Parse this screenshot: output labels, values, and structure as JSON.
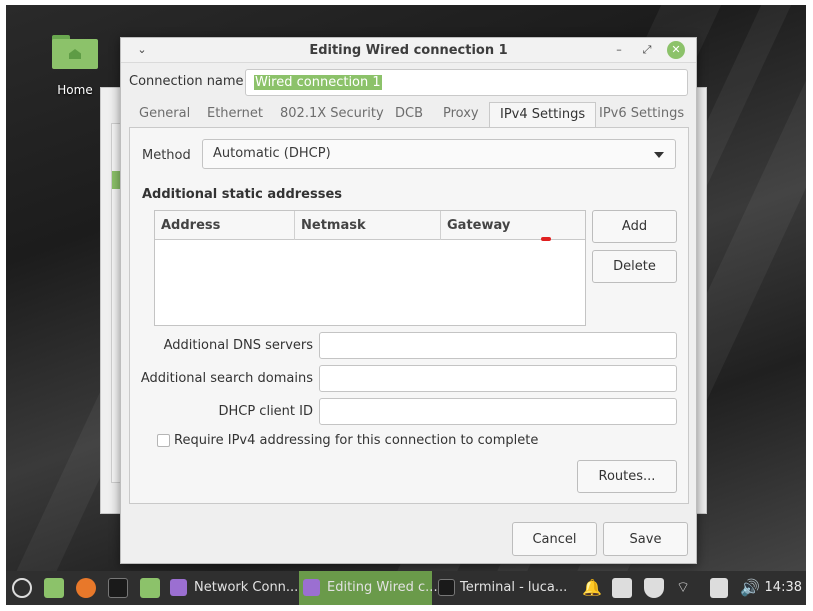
{
  "desktop": {
    "home_label": "Home"
  },
  "dialog": {
    "title": "Editing Wired connection 1",
    "buttons": {
      "menu": "⌄",
      "minimize": "–",
      "maximize": "⤢",
      "close": "✕"
    },
    "connection_name_label": "Connection name",
    "connection_name_value": "Wired connection 1",
    "tabs": [
      {
        "label": "General",
        "active": false
      },
      {
        "label": "Ethernet",
        "active": false
      },
      {
        "label": "802.1X Security",
        "active": false
      },
      {
        "label": "DCB",
        "active": false
      },
      {
        "label": "Proxy",
        "active": false
      },
      {
        "label": "IPv4 Settings",
        "active": true
      },
      {
        "label": "IPv6 Settings",
        "active": false
      }
    ],
    "ipv4": {
      "method_label": "Method",
      "method_value": "Automatic (DHCP)",
      "static_title": "Additional static addresses",
      "columns": [
        "Address",
        "Netmask",
        "Gateway"
      ],
      "rows": [],
      "add_button": "Add",
      "delete_button": "Delete",
      "dns_label": "Additional DNS servers",
      "dns_value": "",
      "search_label": "Additional search domains",
      "search_value": "",
      "dhcp_label": "DHCP client ID",
      "dhcp_value": "",
      "require_label": "Require IPv4 addressing for this connection to complete",
      "require_checked": false,
      "routes_button": "Routes..."
    },
    "cancel_button": "Cancel",
    "save_button": "Save"
  },
  "taskbar": {
    "items": [
      {
        "label": "Network Conn...",
        "icon": "network-connections-icon"
      },
      {
        "label": "Editing Wired c...",
        "icon": "network-connections-icon",
        "active": true
      },
      {
        "label": "Terminal - luca...",
        "icon": "terminal-icon"
      }
    ],
    "clock": "14:38"
  },
  "colors": {
    "accent": "#8cc26a",
    "taskbar": "#2f2f2f",
    "taskbar_active": "#6a9a4a"
  }
}
